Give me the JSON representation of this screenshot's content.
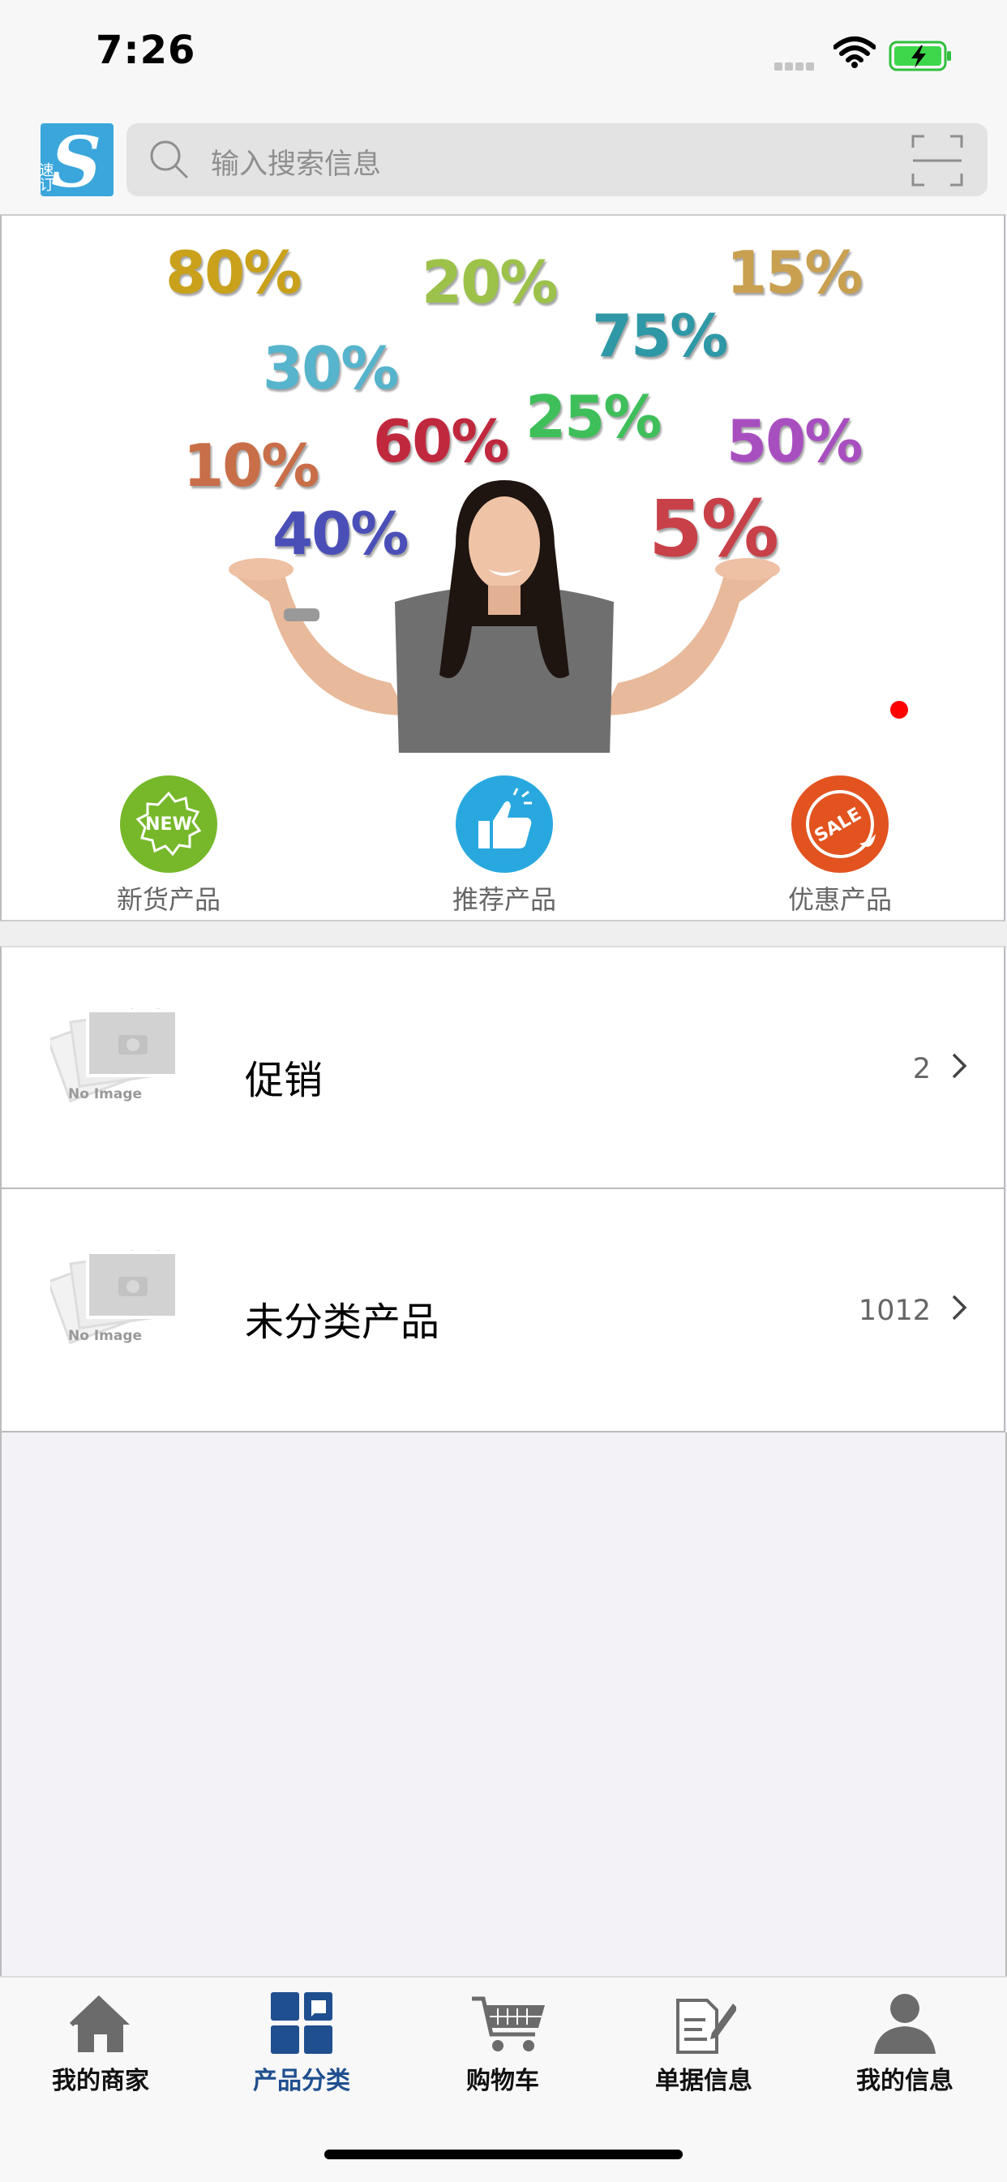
{
  "status": {
    "time": "7:26"
  },
  "header": {
    "logo_text": "速订",
    "logo_letter": "S",
    "search_placeholder": "输入搜索信息"
  },
  "banner": {
    "percentages": [
      "80%",
      "20%",
      "15%",
      "75%",
      "30%",
      "25%",
      "60%",
      "50%",
      "10%",
      "40%",
      "5%"
    ],
    "indicator_color": "#ff0000"
  },
  "shortcuts": [
    {
      "label": "新货产品",
      "icon": "new-badge-icon",
      "badge_text": "NEW",
      "color": "#76b82a"
    },
    {
      "label": "推荐产品",
      "icon": "thumbs-up-icon",
      "color": "#29a8e0"
    },
    {
      "label": "优惠产品",
      "icon": "sale-tag-icon",
      "badge_text": "SALE",
      "color": "#e2531f"
    }
  ],
  "categories": [
    {
      "title": "促销",
      "count": "2",
      "thumb_text": "No Image"
    },
    {
      "title": "未分类产品",
      "count": "1012",
      "thumb_text": "No Image"
    }
  ],
  "tabbar": {
    "active_color": "#1f4f8f",
    "items": [
      {
        "label": "我的商家",
        "icon": "home-icon"
      },
      {
        "label": "产品分类",
        "icon": "grid-icon",
        "active": true
      },
      {
        "label": "购物车",
        "icon": "cart-icon"
      },
      {
        "label": "单据信息",
        "icon": "document-icon"
      },
      {
        "label": "我的信息",
        "icon": "user-icon"
      }
    ]
  }
}
